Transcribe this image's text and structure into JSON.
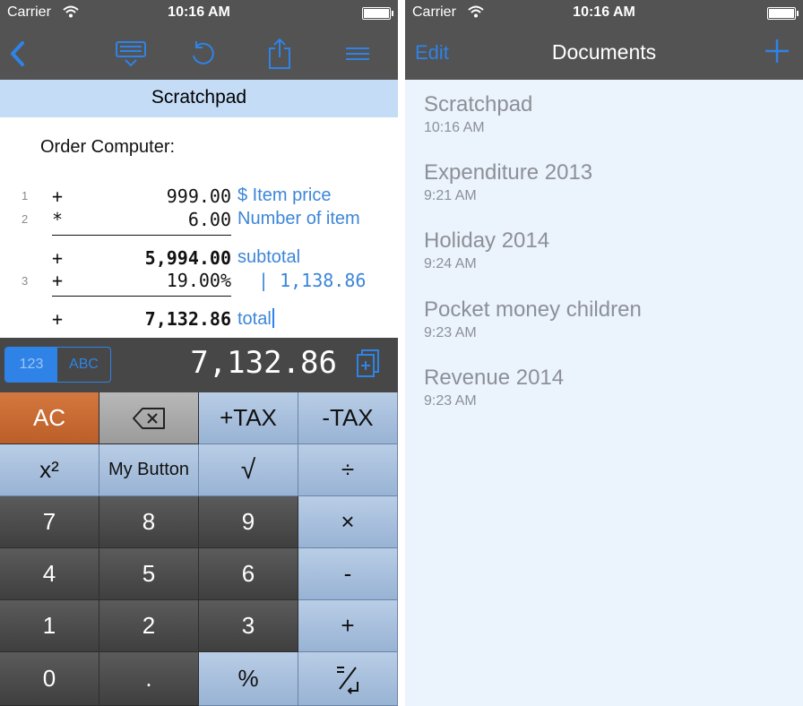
{
  "status": {
    "carrier": "Carrier",
    "time": "10:16 AM"
  },
  "left": {
    "nav_icons": [
      "back-icon",
      "keyboard-icon",
      "undo-icon",
      "share-icon",
      "menu-icon"
    ],
    "doc_title": "Scratchpad",
    "heading": "Order Computer:",
    "lines": [
      {
        "num": "1",
        "op": "+",
        "value": "999.00",
        "comment": "$ Item price"
      },
      {
        "num": "2",
        "op": "*",
        "value": "6.00",
        "comment": "Number of item"
      },
      {
        "num": "",
        "op": "+",
        "value": "5,994.00",
        "comment": "subtotal"
      },
      {
        "num": "3",
        "op": "+",
        "value": "19.00%",
        "comment": "| 1,138.86"
      },
      {
        "num": "",
        "op": "+",
        "value": "7,132.86",
        "comment": "total"
      }
    ],
    "display": {
      "mode_123": "123",
      "mode_abc": "ABC",
      "value": "7,132.86"
    },
    "keys": {
      "ac": "AC",
      "plus_tax": "+TAX",
      "minus_tax": "-TAX",
      "square": "x²",
      "my_button": "My Button",
      "sqrt": "√",
      "divide": "÷",
      "k7": "7",
      "k8": "8",
      "k9": "9",
      "multiply": "×",
      "k4": "4",
      "k5": "5",
      "k6": "6",
      "minus": "-",
      "k1": "1",
      "k2": "2",
      "k3": "3",
      "plus": "+",
      "k0": "0",
      "dot": ".",
      "percent": "%"
    }
  },
  "right": {
    "edit": "Edit",
    "title": "Documents",
    "documents": [
      {
        "name": "Scratchpad",
        "time": "10:16 AM"
      },
      {
        "name": "Expenditure 2013",
        "time": "9:21 AM"
      },
      {
        "name": "Holiday 2014",
        "time": "9:24 AM"
      },
      {
        "name": "Pocket money children",
        "time": "9:23 AM"
      },
      {
        "name": "Revenue 2014",
        "time": "9:23 AM"
      }
    ]
  },
  "colors": {
    "accent": "#2f83e6",
    "bar": "#535353",
    "title_band": "#c5dcf6",
    "list_bg": "#ebf3fd",
    "ac_key": "#c96a31"
  }
}
